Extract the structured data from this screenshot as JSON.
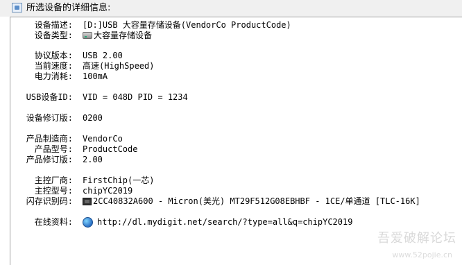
{
  "window": {
    "title": "所选设备的详细信息:"
  },
  "details": {
    "desc_label": "设备描述:",
    "desc_value": "[D:]USB 大容量存储设备(VendorCo ProductCode)",
    "type_label": "设备类型:",
    "type_value": "大容量存储设备",
    "protocol_label": "协议版本:",
    "protocol_value": "USB 2.00",
    "speed_label": "当前速度:",
    "speed_value": "高速(HighSpeed)",
    "power_label": "电力消耗:",
    "power_value": "100mA",
    "usbid_label": "USB设备ID:",
    "usbid_value": "VID = 048D PID = 1234",
    "rev_label": "设备修订版:",
    "rev_value": "0200",
    "maker_label": "产品制造商:",
    "maker_value": "VendorCo",
    "model_label": "产品型号:",
    "model_value": "ProductCode",
    "prodrev_label": "产品修订版:",
    "prodrev_value": "2.00",
    "ctrl_vendor_label": "主控厂商:",
    "ctrl_vendor_value": "FirstChip(一芯)",
    "ctrl_model_label": "主控型号:",
    "ctrl_model_value": "chipYC2019",
    "flash_label": "闪存识别码:",
    "flash_value": "2CC40832A600 - Micron(美光) MT29F512G08EBHBF - 1CE/单通道 [TLC-16K]",
    "online_label": "在线资料:",
    "online_value": "http://dl.mydigit.net/search/?type=all&q=chipYC2019"
  },
  "icons": {
    "type": "disk-icon",
    "flash": "chip-icon",
    "online": "globe-icon"
  },
  "watermark": {
    "text": "吾爱破解论坛",
    "url": "www.52pojie.cn"
  }
}
